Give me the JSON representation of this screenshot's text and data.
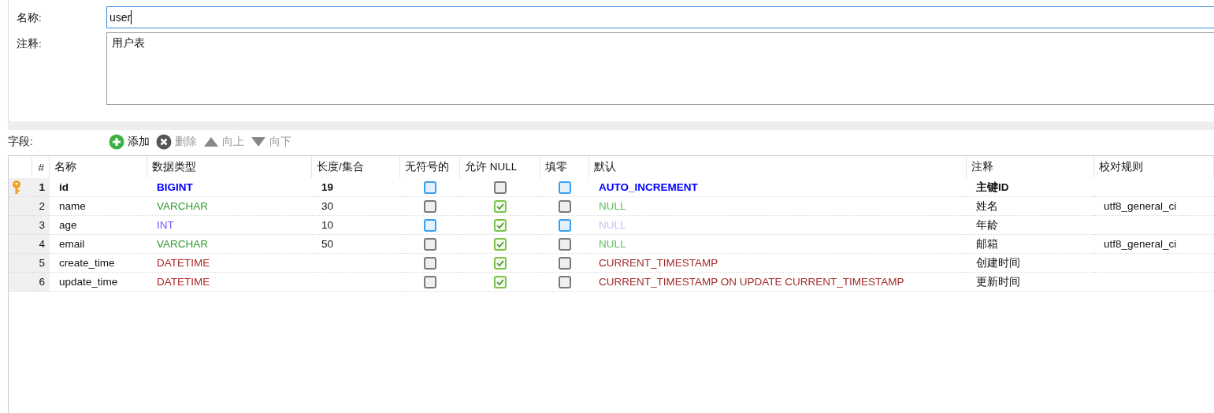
{
  "form": {
    "name_label": "名称:",
    "name_value": "user",
    "comment_label": "注释:",
    "comment_value": "用户表"
  },
  "fields_toolbar": {
    "label": "字段:",
    "actions": [
      {
        "kind": "add",
        "label": "添加",
        "disabled": false
      },
      {
        "kind": "delete",
        "label": "删除",
        "disabled": true
      },
      {
        "kind": "up",
        "label": "向上",
        "disabled": true
      },
      {
        "kind": "down",
        "label": "向下",
        "disabled": true
      }
    ]
  },
  "table": {
    "columns": [
      "#",
      "名称",
      "数据类型",
      "长度/集合",
      "无符号的",
      "允许 NULL",
      "填零",
      "默认",
      "注释",
      "校对规则"
    ],
    "rows": [
      {
        "primary_key": true,
        "index": "1",
        "name": "id",
        "type": {
          "text": "BIGINT",
          "color": "#0000ff"
        },
        "length": "19",
        "unsigned": {
          "checked": false,
          "enabled": true
        },
        "allow_null": {
          "checked": false,
          "enabled": false
        },
        "zerofill": {
          "checked": false,
          "enabled": true
        },
        "default": {
          "text": "AUTO_INCREMENT",
          "color": "#0000ff"
        },
        "comment": "主键ID",
        "collation": ""
      },
      {
        "primary_key": false,
        "index": "2",
        "name": "name",
        "type": {
          "text": "VARCHAR",
          "color": "#2e9a2e"
        },
        "length": "30",
        "unsigned": {
          "checked": false,
          "enabled": false
        },
        "allow_null": {
          "checked": true,
          "enabled": true
        },
        "zerofill": {
          "checked": false,
          "enabled": false
        },
        "default": {
          "text": "NULL",
          "color": "#5cc05c"
        },
        "comment": "姓名",
        "collation": "utf8_general_ci"
      },
      {
        "primary_key": false,
        "index": "3",
        "name": "age",
        "type": {
          "text": "INT",
          "color": "#6a5cff"
        },
        "length": "10",
        "unsigned": {
          "checked": false,
          "enabled": true
        },
        "allow_null": {
          "checked": true,
          "enabled": true
        },
        "zerofill": {
          "checked": false,
          "enabled": true
        },
        "default": {
          "text": "NULL",
          "color": "#c4c4ee"
        },
        "comment": "年龄",
        "collation": ""
      },
      {
        "primary_key": false,
        "index": "4",
        "name": "email",
        "type": {
          "text": "VARCHAR",
          "color": "#2e9a2e"
        },
        "length": "50",
        "unsigned": {
          "checked": false,
          "enabled": false
        },
        "allow_null": {
          "checked": true,
          "enabled": true
        },
        "zerofill": {
          "checked": false,
          "enabled": false
        },
        "default": {
          "text": "NULL",
          "color": "#5cc05c"
        },
        "comment": "邮箱",
        "collation": "utf8_general_ci"
      },
      {
        "primary_key": false,
        "index": "5",
        "name": "create_time",
        "type": {
          "text": "DATETIME",
          "color": "#b02828"
        },
        "length": "",
        "unsigned": {
          "checked": false,
          "enabled": false
        },
        "allow_null": {
          "checked": true,
          "enabled": true
        },
        "zerofill": {
          "checked": false,
          "enabled": false
        },
        "default": {
          "text": "CURRENT_TIMESTAMP",
          "color": "#a52a2a"
        },
        "comment": "创建时间",
        "collation": ""
      },
      {
        "primary_key": false,
        "index": "6",
        "name": "update_time",
        "type": {
          "text": "DATETIME",
          "color": "#b02828"
        },
        "length": "",
        "unsigned": {
          "checked": false,
          "enabled": false
        },
        "allow_null": {
          "checked": true,
          "enabled": true
        },
        "zerofill": {
          "checked": false,
          "enabled": false
        },
        "default": {
          "text": "CURRENT_TIMESTAMP ON UPDATE CURRENT_TIMESTAMP",
          "color": "#a52a2a"
        },
        "comment": "更新时间",
        "collation": ""
      }
    ]
  }
}
